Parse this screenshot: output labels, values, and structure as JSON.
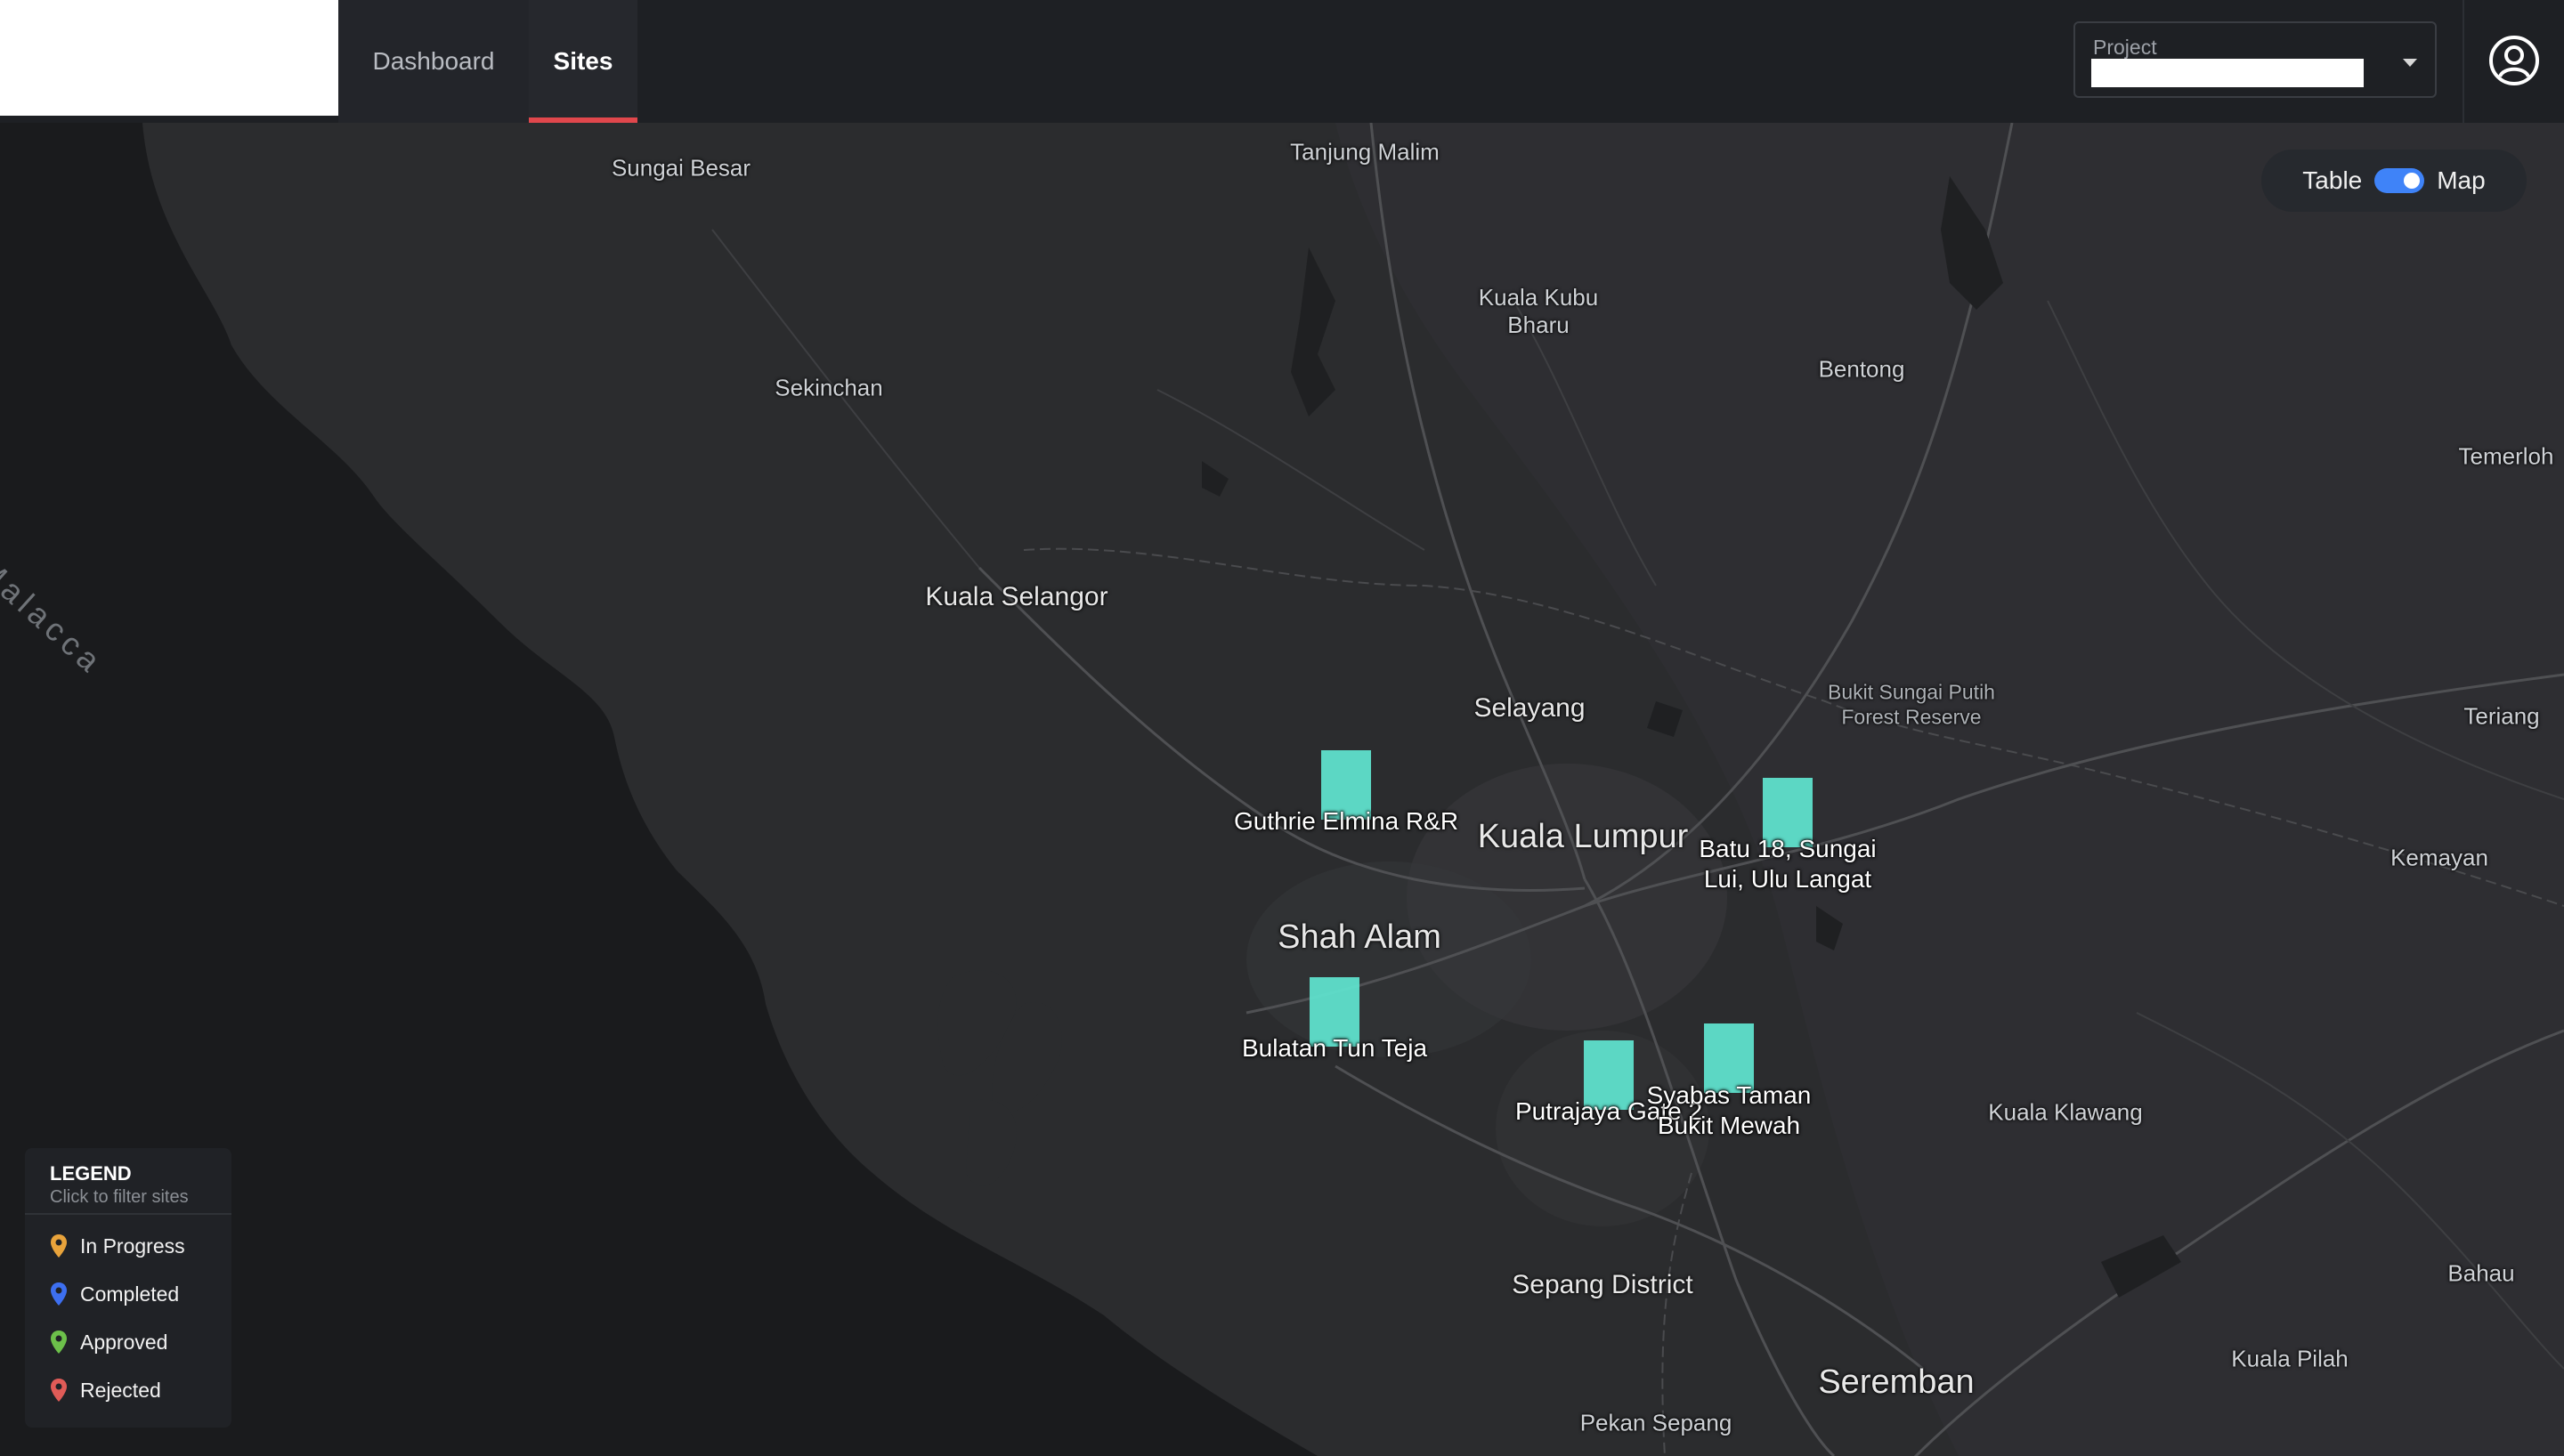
{
  "nav": {
    "tabs": [
      {
        "label": "Dashboard",
        "active": false
      },
      {
        "label": "Sites",
        "active": true
      }
    ]
  },
  "project": {
    "label": "Project",
    "value": ""
  },
  "view_toggle": {
    "left_label": "Table",
    "right_label": "Map",
    "selected": "Map"
  },
  "map": {
    "sea_label": "Malacca",
    "places": [
      {
        "name": "Sungai Besar"
      },
      {
        "name": "Tanjung Malim"
      },
      {
        "name": "Kuala Kubu\nBharu"
      },
      {
        "name": "Sekinchan"
      },
      {
        "name": "Bentong"
      },
      {
        "name": "Temerloh"
      },
      {
        "name": "Kuala Selangor"
      },
      {
        "name": "Selayang"
      },
      {
        "name": "Bukit Sungai Putih\nForest Reserve"
      },
      {
        "name": "Teriang"
      },
      {
        "name": "Kuala Lumpur"
      },
      {
        "name": "Kemayan"
      },
      {
        "name": "Shah Alam"
      },
      {
        "name": "Kuala Klawang"
      },
      {
        "name": "Bahau"
      },
      {
        "name": "Sepang District"
      },
      {
        "name": "Kuala Pilah"
      },
      {
        "name": "Seremban"
      },
      {
        "name": "Pekan Sepang"
      }
    ],
    "sites": [
      {
        "label": "Guthrie Elmina R&R"
      },
      {
        "label": "Batu 18, Sungai\nLui, Ulu Langat"
      },
      {
        "label": "Bulatan Tun Teja"
      },
      {
        "label": "Putrajaya Gate 2"
      },
      {
        "label": "Syabas Taman\nBukit Mewah"
      }
    ],
    "marker_color": "#5fe0cc"
  },
  "legend": {
    "title": "LEGEND",
    "subtitle": "Click to filter sites",
    "items": [
      {
        "label": "In Progress",
        "color": "#e8a33b"
      },
      {
        "label": "Completed",
        "color": "#3d6ff0"
      },
      {
        "label": "Approved",
        "color": "#6cc04a"
      },
      {
        "label": "Rejected",
        "color": "#e05b57"
      }
    ]
  }
}
